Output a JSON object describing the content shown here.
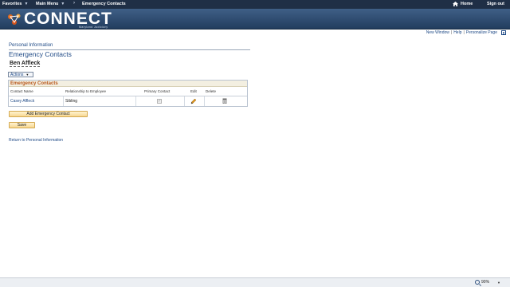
{
  "topbar": {
    "favorites": "Favorites",
    "main_menu": "Main Menu",
    "breadcrumb_sep": "›",
    "breadcrumb_current": "Emergency Contacts",
    "home": "Home",
    "sign_out": "Sign out"
  },
  "banner": {
    "logo_text": "CONNECT",
    "logo_sub": "Maryland Judiciary"
  },
  "pagelinks": {
    "new_window": "New Window",
    "help": "Help",
    "personalize": "Personalize Page",
    "sep": "|"
  },
  "page": {
    "section": "Personal Information",
    "title": "Emergency Contacts",
    "employee_name": "Ben Affleck",
    "actions_label": "Actions"
  },
  "grid": {
    "title": "Emergency Contacts",
    "columns": [
      "Contact Name",
      "Relationship to Employee",
      "Primary Contact",
      "Edit",
      "Delete"
    ],
    "rows": [
      {
        "contact_name": "Casey Affleck",
        "relationship": "Sibling",
        "primary": true
      }
    ]
  },
  "buttons": {
    "add_contact": "Add Emergency Contact",
    "save": "Save"
  },
  "links": {
    "return": "Return to Personal Information"
  },
  "statusbar": {
    "zoom": "90%"
  }
}
